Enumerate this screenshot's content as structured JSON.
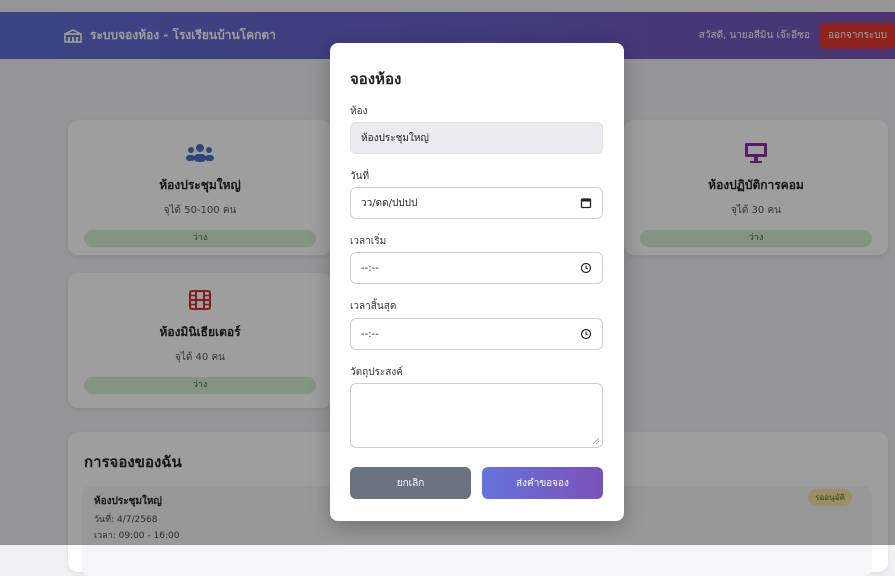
{
  "header": {
    "title": "ระบบจองห้อง - โรงเรียนบ้านโคกตา",
    "greeting": "สวัสดี, นายอสีมิน เจ๊ะอีซอ",
    "logout_label": "ออกจากระบบ",
    "brand_icon": "building-icon"
  },
  "rooms": [
    {
      "name": "ห้องประชุมใหญ่",
      "capacity": "จุได้ 50-100 คน",
      "status": "ว่าง",
      "icon": "users-icon",
      "icon_color": "#4a73c9"
    },
    {
      "name": "ห้องปฏิบัติการคอม",
      "capacity": "จุได้ 30 คน",
      "status": "ว่าง",
      "icon": "monitor-icon",
      "icon_color": "#8e2ea8"
    },
    {
      "name": "ห้องมินิเธียเตอร์",
      "capacity": "จุได้ 40 คน",
      "status": "ว่าง",
      "icon": "film-icon",
      "icon_color": "#d32f2f"
    }
  ],
  "my_bookings": {
    "title": "การจองของฉัน",
    "items": [
      {
        "room": "ห้องประชุมใหญ่",
        "date": "วันที่: 4/7/2568",
        "time": "เวลา: 09:00 - 16:00",
        "status": "รออนุมัติ"
      }
    ]
  },
  "modal": {
    "title": "จองห้อง",
    "room_label": "ห้อง",
    "room_value": "ห้องประชุมใหญ่",
    "date_label": "วันที่",
    "date_placeholder": "วว/ดด/ปปปป",
    "start_label": "เวลาเริ่ม",
    "start_placeholder": "--:--",
    "end_label": "เวลาสิ้นสุด",
    "end_placeholder": "--:--",
    "purpose_label": "วัตถุประสงค์",
    "purpose_value": "",
    "cancel_label": "ยกเลิก",
    "submit_label": "ส่งคำขอจอง"
  },
  "colors": {
    "header_start": "#5f6fd6",
    "header_end": "#7a54b8",
    "logout": "#e53935",
    "available_bg": "#d5edd4",
    "pending_bg": "#f5e7a8",
    "cancel_button": "#6b7280"
  }
}
